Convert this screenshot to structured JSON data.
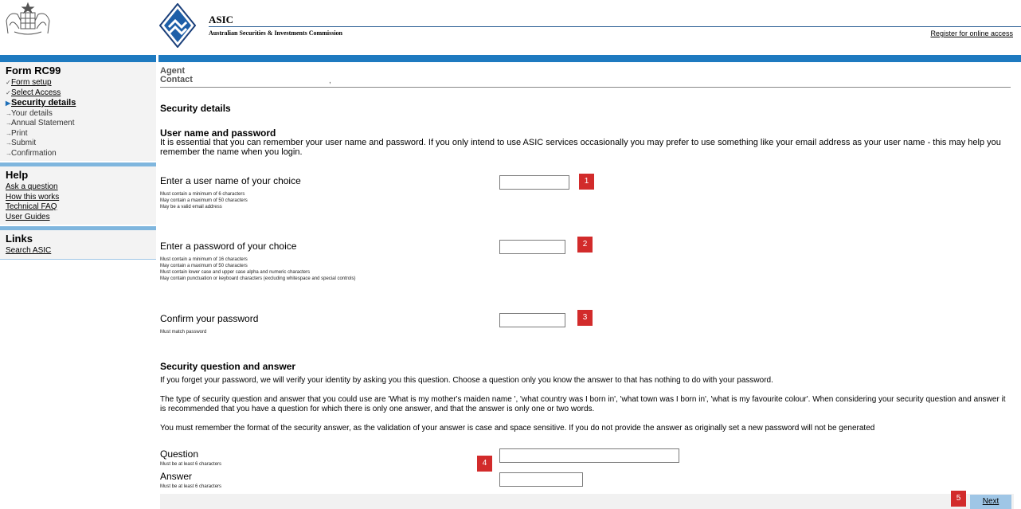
{
  "header": {
    "logo_title": "ASIC",
    "logo_subtitle": "Australian Securities & Investments Commission",
    "register_link": "Register for online access"
  },
  "sidebar": {
    "form_title": "Form RC99",
    "steps": [
      {
        "label": "Form setup",
        "state": "done"
      },
      {
        "label": "Select Access",
        "state": "done"
      },
      {
        "label": "Security details",
        "state": "current"
      },
      {
        "label": "Your details",
        "state": "pending"
      },
      {
        "label": "Annual Statement",
        "state": "pending"
      },
      {
        "label": "Print",
        "state": "pending"
      },
      {
        "label": "Submit",
        "state": "pending"
      },
      {
        "label": "Confirmation",
        "state": "pending"
      }
    ],
    "help_title": "Help",
    "help_links": [
      "Ask a question",
      "How this works",
      "Technical FAQ",
      "User Guides"
    ],
    "links_title": "Links",
    "links": [
      "Search ASIC"
    ]
  },
  "main": {
    "agent_label": "Agent",
    "contact_label": "Contact",
    "contact_value": ",",
    "page_title": "Security details",
    "user_pass_heading": "User name and password",
    "user_pass_intro": "It is essential that you can remember your user name and password. If you only intend to use ASIC services occasionally you may prefer to use something like your email address as your user name - this may help you remember the name when you login.",
    "username": {
      "label": "Enter a user name of your choice",
      "help": [
        "Must contain a minimum of 6 characters",
        "May contain a maximum of 50 characters",
        "May be a valid email address"
      ],
      "value": "",
      "badge": "1"
    },
    "password": {
      "label": "Enter a password of your choice",
      "help": [
        "Must contain a minimum of 16 characters",
        "May contain a maximum of 50 characters",
        "Must contain lower case and upper case alpha and numeric characters",
        "May contain punctuation or keyboard characters (excluding whitespace and special controls)"
      ],
      "value": "",
      "badge": "2"
    },
    "confirm": {
      "label": "Confirm your password",
      "help": [
        "Must match password"
      ],
      "value": "",
      "badge": "3"
    },
    "security_heading": "Security question and answer",
    "security_paras": [
      "If you forget your password, we will verify your identity by asking you this question. Choose a question only you know the answer to that has nothing to do with your password.",
      "The type of security question and answer that you could use are 'What is my mother's maiden name ', 'what country was I born in', 'what town was I born in', 'what is my favourite colour'. When considering your security question and answer it is recommended that you have a question for which there is only one answer, and that the answer is only one or two words.",
      "You must remember the format of the security answer, as the validation of your answer is case and space sensitive. If you do not provide the answer as originally set a new password will not be generated"
    ],
    "question": {
      "label": "Question",
      "help": "Must be at least 6 characters",
      "value": ""
    },
    "answer": {
      "label": "Answer",
      "help": "Must be at least 6 characters",
      "value": ""
    },
    "qa_badge": "4",
    "next_badge": "5",
    "next_label": "Next"
  },
  "colors": {
    "brand_blue": "#1e7ac0",
    "light_blue": "#9fc6e6",
    "badge_red": "#d22b2b"
  }
}
